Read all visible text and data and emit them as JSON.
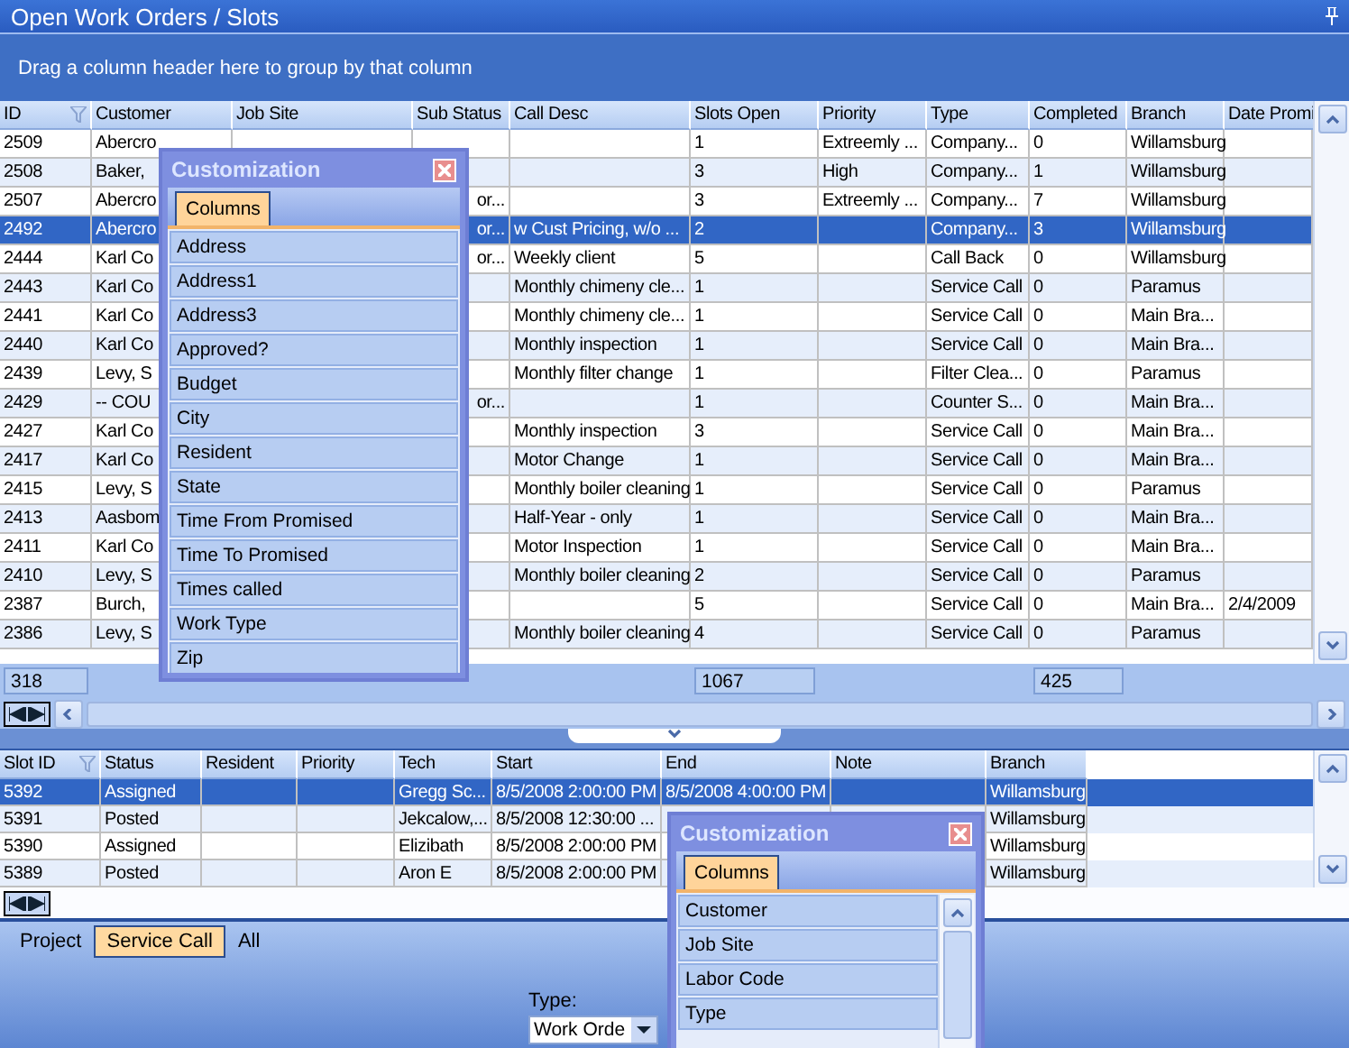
{
  "window": {
    "title": "Open Work Orders / Slots"
  },
  "group_panel": {
    "hint": "Drag a column header here to group by that column"
  },
  "work_orders": {
    "columns": [
      "ID",
      "Customer",
      "Job Site",
      "Sub Status",
      "Call Desc",
      "Slots Open",
      "Priority",
      "Type",
      "Completed",
      "Branch",
      "Date Promi"
    ],
    "rows": [
      {
        "id": "2509",
        "customer": "Abercro",
        "slots_open": "1",
        "priority": "Extreemly ...",
        "type": "Company...",
        "completed": "0",
        "branch": "Willamsburg",
        "selected": false
      },
      {
        "id": "2508",
        "customer": "Baker,",
        "slots_open": "3",
        "priority": "High",
        "type": "Company...",
        "completed": "1",
        "branch": "Willamsburg",
        "selected": false
      },
      {
        "id": "2507",
        "customer": "Abercro",
        "sub_status": "or...",
        "slots_open": "3",
        "priority": "Extreemly ...",
        "type": "Company...",
        "completed": "7",
        "branch": "Willamsburg",
        "selected": false
      },
      {
        "id": "2492",
        "customer": "Abercro",
        "sub_status": "or...",
        "call_desc": "w Cust Pricing, w/o ...",
        "slots_open": "2",
        "type": "Company...",
        "completed": "3",
        "branch": "Willamsburg",
        "selected": true
      },
      {
        "id": "2444",
        "customer": "Karl Co",
        "sub_status": "or...",
        "call_desc": "Weekly client",
        "slots_open": "5",
        "type": "Call Back",
        "completed": "0",
        "branch": "Willamsburg",
        "selected": false
      },
      {
        "id": "2443",
        "customer": "Karl Co",
        "call_desc": "Monthly chimeny cle...",
        "slots_open": "1",
        "type": "Service Call",
        "completed": "0",
        "branch": "Paramus",
        "selected": false
      },
      {
        "id": "2441",
        "customer": "Karl Co",
        "call_desc": "Monthly chimeny cle...",
        "slots_open": "1",
        "type": "Service Call",
        "completed": "0",
        "branch": "Main Bra...",
        "selected": false
      },
      {
        "id": "2440",
        "customer": "Karl Co",
        "call_desc": "Monthly inspection",
        "slots_open": "1",
        "type": "Service Call",
        "completed": "0",
        "branch": "Main Bra...",
        "selected": false
      },
      {
        "id": "2439",
        "customer": "Levy, S",
        "call_desc": "Monthly filter change",
        "slots_open": "1",
        "type": "Filter Clea...",
        "completed": "0",
        "branch": "Paramus",
        "selected": false
      },
      {
        "id": "2429",
        "customer": "-- COU",
        "sub_status": "or...",
        "slots_open": "1",
        "type": "Counter S...",
        "completed": "0",
        "branch": "Main Bra...",
        "selected": false
      },
      {
        "id": "2427",
        "customer": "Karl Co",
        "call_desc": "Monthly inspection",
        "slots_open": "3",
        "type": "Service Call",
        "completed": "0",
        "branch": "Main Bra...",
        "selected": false
      },
      {
        "id": "2417",
        "customer": "Karl Co",
        "call_desc": "Motor Change",
        "slots_open": "1",
        "type": "Service Call",
        "completed": "0",
        "branch": "Main Bra...",
        "selected": false
      },
      {
        "id": "2415",
        "customer": "Levy, S",
        "call_desc": "Monthly boiler cleaning",
        "slots_open": "1",
        "type": "Service Call",
        "completed": "0",
        "branch": "Paramus",
        "selected": false
      },
      {
        "id": "2413",
        "customer": "Aasbom",
        "call_desc": "Half-Year - only",
        "slots_open": "1",
        "type": "Service Call",
        "completed": "0",
        "branch": "Main Bra...",
        "selected": false
      },
      {
        "id": "2411",
        "customer": "Karl Co",
        "call_desc": "Motor Inspection",
        "slots_open": "1",
        "type": "Service Call",
        "completed": "0",
        "branch": "Main Bra...",
        "selected": false
      },
      {
        "id": "2410",
        "customer": "Levy, S",
        "call_desc": "Monthly boiler cleaning",
        "slots_open": "2",
        "type": "Service Call",
        "completed": "0",
        "branch": "Paramus",
        "selected": false
      },
      {
        "id": "2387",
        "customer": "Burch,",
        "slots_open": "5",
        "type": "Service Call",
        "completed": "0",
        "branch": "Main Bra...",
        "date_promised": "2/4/2009",
        "selected": false
      },
      {
        "id": "2386",
        "customer": "Levy, S",
        "call_desc": "Monthly boiler cleaning",
        "slots_open": "4",
        "type": "Service Call",
        "completed": "0",
        "branch": "Paramus",
        "selected": false
      }
    ],
    "footer": {
      "id": "318",
      "slots_open": "1067",
      "completed": "425"
    }
  },
  "slots": {
    "columns": [
      "Slot ID",
      "Status",
      "Resident",
      "Priority",
      "Tech",
      "Start",
      "End",
      "Note",
      "Branch"
    ],
    "rows": [
      {
        "slot_id": "5392",
        "status": "Assigned",
        "tech": "Gregg Sc...",
        "start": "8/5/2008 2:00:00 PM",
        "end": "8/5/2008 4:00:00 PM",
        "branch": "Willamsburg",
        "selected": true
      },
      {
        "slot_id": "5391",
        "status": "Posted",
        "tech": "Jekcalow,...",
        "start": "8/5/2008 12:30:00 ...",
        "branch": "Willamsburg",
        "selected": false
      },
      {
        "slot_id": "5390",
        "status": "Assigned",
        "tech": "Elizibath",
        "start": "8/5/2008 2:00:00 PM",
        "branch": "Willamsburg",
        "selected": false
      },
      {
        "slot_id": "5389",
        "status": "Posted",
        "tech": "Aron E",
        "start": "8/5/2008 2:00:00 PM",
        "branch": "Willamsburg",
        "selected": false
      }
    ]
  },
  "view_tabs": [
    {
      "label": "Project",
      "selected": false
    },
    {
      "label": "Service Call",
      "selected": true
    },
    {
      "label": "All",
      "selected": false
    }
  ],
  "type_filter": {
    "label": "Type:",
    "value": "Work Orde"
  },
  "customization_dialogs": [
    {
      "title": "Customization",
      "tabs": [
        {
          "label": "Columns",
          "selected": true
        }
      ],
      "items": [
        "Address",
        "Address1",
        "Address3",
        "Approved?",
        "Budget",
        "City",
        "Resident",
        "State",
        "Time From Promised",
        "Time To Promised",
        "Times called",
        "Work Type",
        "Zip"
      ],
      "scrollable": false
    },
    {
      "title": "Customization",
      "tabs": [
        {
          "label": "Columns",
          "selected": true
        }
      ],
      "items": [
        "Customer",
        "Job Site",
        "Labor Code",
        "Type"
      ],
      "scrollable": true
    }
  ]
}
